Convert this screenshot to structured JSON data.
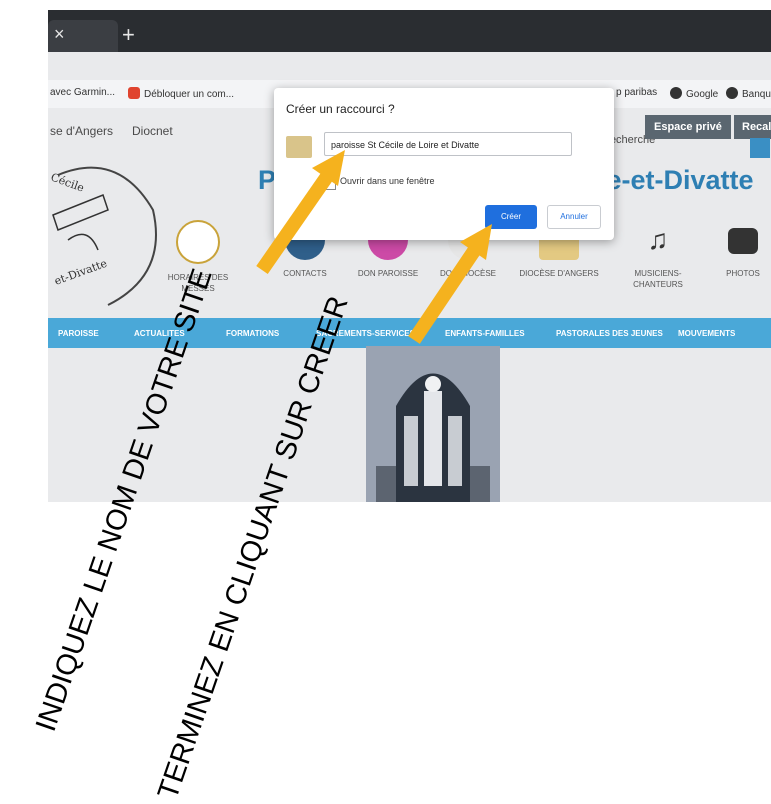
{
  "browser": {
    "tab_close": "×",
    "tab_new": "+"
  },
  "bookmarks": [
    {
      "label": "avec Garmin...",
      "color": "#f3f4f6"
    },
    {
      "label": "Débloquer un com...",
      "color": "#e0442f"
    },
    {
      "label": "p paribas",
      "color": "#f3f4f6"
    },
    {
      "label": "Google",
      "color": "#333333"
    },
    {
      "label": "Banque",
      "color": "#333333"
    }
  ],
  "site_nav": {
    "items": [
      "se d'Angers",
      "Diocnet"
    ],
    "search_placeholder": "Recherche",
    "espace_prive": "Espace privé",
    "recalc": "Recalc"
  },
  "site": {
    "title_left": "P",
    "title_right": "re-et-Divatte",
    "tiles": [
      {
        "label": "HORAIRES DES MESSES"
      },
      {
        "label": "CONTACTS"
      },
      {
        "label": "DON PAROISSE"
      },
      {
        "label": "DON DIOCÈSE"
      },
      {
        "label": "DIOCÈSE D'ANGERS"
      },
      {
        "label": "MUSICIENS-CHANTEURS"
      },
      {
        "label": "PHOTOS"
      }
    ],
    "menu": [
      "PAROISSE",
      "ACTUALITES",
      "FORMATIONS",
      "SACREMENTS-SERVICES",
      "ENFANTS-FAMILLES",
      "PASTORALES DES JEUNES",
      "MOUVEMENTS"
    ]
  },
  "dialog": {
    "title": "Créer un raccourci ?",
    "name_value": "paroisse St Cécile de Loire et Divatte",
    "open_window_label": "Ouvrir dans une fenêtre",
    "create_label": "Créer",
    "cancel_label": "Annuler"
  },
  "annotations": {
    "step1": "INDIQUEZ LE NOM DE VOTRE SITE",
    "step2": "TERMINEZ EN CLIQUANT SUR CREER",
    "arrow_color": "#f5b21e"
  }
}
